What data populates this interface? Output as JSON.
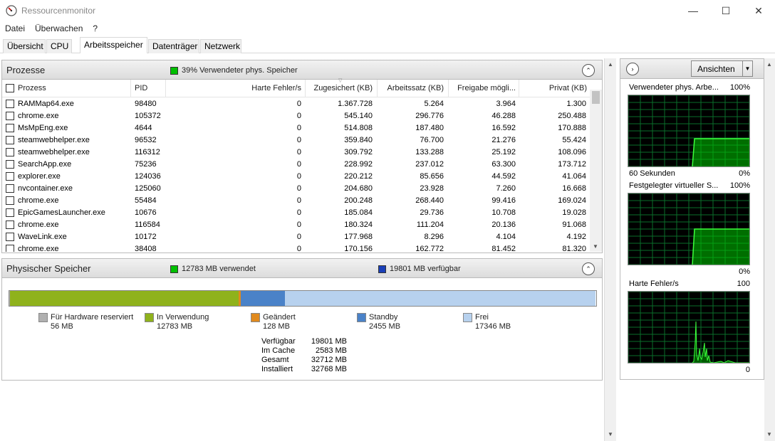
{
  "window": {
    "title": "Ressourcenmonitor",
    "minimize": "—",
    "maximize": "☐",
    "close": "✕"
  },
  "menu": [
    "Datei",
    "Überwachen",
    "?"
  ],
  "tabs": [
    "Übersicht",
    "CPU",
    "Arbeitsspeicher",
    "Datenträger",
    "Netzwerk"
  ],
  "active_tab": "Arbeitsspeicher",
  "processes": {
    "title": "Prozesse",
    "summary": "39% Verwendeter phys. Speicher",
    "summary_color": "#00c000",
    "columns": [
      "Prozess",
      "PID",
      "Harte Fehler/s",
      "Zugesichert (KB)",
      "Arbeitssatz (KB)",
      "Freigabe mögli...",
      "Privat (KB)"
    ],
    "rows": [
      [
        "RAMMap64.exe",
        "98480",
        "0",
        "1.367.728",
        "5.264",
        "3.964",
        "1.300"
      ],
      [
        "chrome.exe",
        "105372",
        "0",
        "545.140",
        "296.776",
        "46.288",
        "250.488"
      ],
      [
        "MsMpEng.exe",
        "4644",
        "0",
        "514.808",
        "187.480",
        "16.592",
        "170.888"
      ],
      [
        "steamwebhelper.exe",
        "96532",
        "0",
        "359.840",
        "76.700",
        "21.276",
        "55.424"
      ],
      [
        "steamwebhelper.exe",
        "116312",
        "0",
        "309.792",
        "133.288",
        "25.192",
        "108.096"
      ],
      [
        "SearchApp.exe",
        "75236",
        "0",
        "228.992",
        "237.012",
        "63.300",
        "173.712"
      ],
      [
        "explorer.exe",
        "124036",
        "0",
        "220.212",
        "85.656",
        "44.592",
        "41.064"
      ],
      [
        "nvcontainer.exe",
        "125060",
        "0",
        "204.680",
        "23.928",
        "7.260",
        "16.668"
      ],
      [
        "chrome.exe",
        "55484",
        "0",
        "200.248",
        "268.440",
        "99.416",
        "169.024"
      ],
      [
        "EpicGamesLauncher.exe",
        "10676",
        "0",
        "185.084",
        "29.736",
        "10.708",
        "19.028"
      ],
      [
        "chrome.exe",
        "116584",
        "0",
        "180.324",
        "111.204",
        "20.136",
        "91.068"
      ],
      [
        "WaveLink.exe",
        "10172",
        "0",
        "177.968",
        "8.296",
        "4.104",
        "4.192"
      ],
      [
        "chrome.exe",
        "38408",
        "0",
        "170.156",
        "162.772",
        "81.452",
        "81.320"
      ]
    ]
  },
  "physical": {
    "title": "Physischer Speicher",
    "used_summary": "12783 MB verwendet",
    "used_color": "#00c000",
    "avail_summary": "19801 MB verfügbar",
    "avail_color": "#1a3fb8",
    "bar": [
      {
        "mb": 56,
        "color": "#b0b0b0"
      },
      {
        "mb": 12783,
        "color": "#8fb21c"
      },
      {
        "mb": 128,
        "color": "#e08a1e"
      },
      {
        "mb": 2455,
        "color": "#4a82c8"
      },
      {
        "mb": 17346,
        "color": "#b7d1ee"
      }
    ],
    "legend": [
      {
        "name": "Für Hardware reserviert",
        "value": "56 MB",
        "color": "#b0b0b0"
      },
      {
        "name": "In Verwendung",
        "value": "12783 MB",
        "color": "#8fb21c"
      },
      {
        "name": "Geändert",
        "value": "128 MB",
        "color": "#e08a1e"
      },
      {
        "name": "Standby",
        "value": "2455 MB",
        "color": "#4a82c8"
      },
      {
        "name": "Frei",
        "value": "17346 MB",
        "color": "#b7d1ee"
      }
    ],
    "stats": [
      {
        "label": "Verfügbar",
        "value": "19801 MB"
      },
      {
        "label": "Im Cache",
        "value": "2583 MB"
      },
      {
        "label": "Gesamt",
        "value": "32712 MB"
      },
      {
        "label": "Installiert",
        "value": "32768 MB"
      }
    ]
  },
  "right": {
    "views_label": "Ansichten",
    "graphs": [
      {
        "title": "Verwendeter phys. Arbe...",
        "max": "100%",
        "foot_left": "60 Sekunden",
        "foot_right": "0%",
        "level_fraction": 0.39,
        "step_at_fraction": 0.53
      },
      {
        "title": "Festgelegter virtueller S...",
        "max": "100%",
        "foot_left": "",
        "foot_right": "0%",
        "level_fraction": 0.5,
        "step_at_fraction": 0.53
      },
      {
        "title": "Harte Fehler/s",
        "max": "100",
        "foot_left": "",
        "foot_right": "0"
      }
    ]
  }
}
